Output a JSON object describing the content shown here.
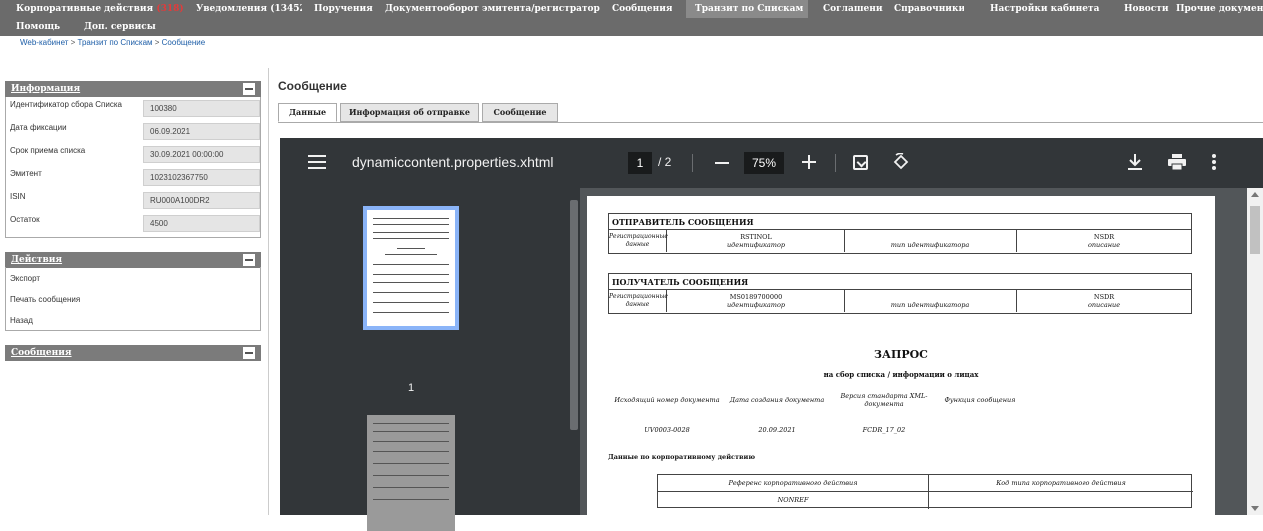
{
  "nav": {
    "row1": [
      {
        "label": "Корпоративные действия",
        "badge": "(318)"
      },
      {
        "label": "Уведомления (13452)"
      },
      {
        "label": "Поручения"
      },
      {
        "label": "Документооборот эмитента/регистратора"
      },
      {
        "label": "Сообщения"
      },
      {
        "label": "Транзит по Спискам",
        "active": true
      },
      {
        "label": "Соглашения"
      },
      {
        "label": "Справочники"
      },
      {
        "label": "Настройки кабинета"
      },
      {
        "label": "Новости"
      },
      {
        "label": "Прочие документы"
      }
    ],
    "row2": [
      {
        "label": "Помощь"
      },
      {
        "label": "Доп. сервисы"
      }
    ]
  },
  "breadcrumb": {
    "items": [
      "Web-кабинет",
      "Транзит по Спискам",
      "Сообщение"
    ],
    "separator": " > "
  },
  "info_panel": {
    "title": "Информация",
    "rows": [
      {
        "label": "Идентификатор сбора Списка",
        "value": "100380"
      },
      {
        "label": "Дата фиксации",
        "value": "06.09.2021"
      },
      {
        "label": "Срок приема списка",
        "value": "30.09.2021 00:00:00"
      },
      {
        "label": "Эмитент",
        "value": "1023102367750"
      },
      {
        "label": "ISIN",
        "value": "RU000A100DR2"
      },
      {
        "label": "Остаток",
        "value": "4500"
      }
    ]
  },
  "actions_panel": {
    "title": "Действия",
    "items": [
      "Экспорт",
      "Печать сообщения",
      "Назад"
    ]
  },
  "messages_panel": {
    "title": "Сообщения"
  },
  "main": {
    "title": "Сообщение",
    "tabs": [
      {
        "label": "Данные",
        "active": true
      },
      {
        "label": "Информация об отправке"
      },
      {
        "label": "Сообщение"
      }
    ]
  },
  "viewer": {
    "filename": "dynamiccontent.properties.xhtml",
    "page_current": "1",
    "page_total": "/ 2",
    "zoom": "75%",
    "thumbnail_label": "1",
    "icons": [
      "menu-icon",
      "fit-page-icon",
      "rotate-icon",
      "download-icon",
      "print-icon",
      "more-icon"
    ]
  },
  "document": {
    "sender": {
      "header": "ОТПРАВИТЕЛЬ СООБЩЕНИЯ",
      "row_label": "Регистрационные данные",
      "id_value": "RSTINOL",
      "id_caption": "идентификатор",
      "type_caption": "тип идентификатора",
      "desc_value": "NSDR",
      "desc_caption": "описание"
    },
    "recipient": {
      "header": "ПОЛУЧАТЕЛЬ СООБЩЕНИЯ",
      "row_label": "Регистрационные данные",
      "id_value": "MS0189700000",
      "id_caption": "идентификатор",
      "type_caption": "тип идентификатора",
      "desc_value": "NSDR",
      "desc_caption": "описание"
    },
    "title": "ЗАПРОС",
    "subtitle": "на сбор списка / информации о лицах",
    "meta_labels": [
      "Исходящий номер документа",
      "Дата создания документа",
      "Версия стандарта XML-документа",
      "Функция сообщения"
    ],
    "meta_values": [
      "UV0003-0028",
      "20.09.2021",
      "FCDR_17_02",
      ""
    ],
    "ca_section": "Данные по корпоративному действию",
    "ca_headers": [
      "Референс корпоративного действия",
      "Код типа корпоративного действия"
    ],
    "ca_values": [
      "NONREF",
      ""
    ]
  },
  "colors": {
    "nav_bg": "#6b6b6b",
    "badge": "#e23b3b",
    "link": "#1f5fa8",
    "viewer_toolbar": "#323639",
    "thumb_selected": "#8ab4f8"
  }
}
